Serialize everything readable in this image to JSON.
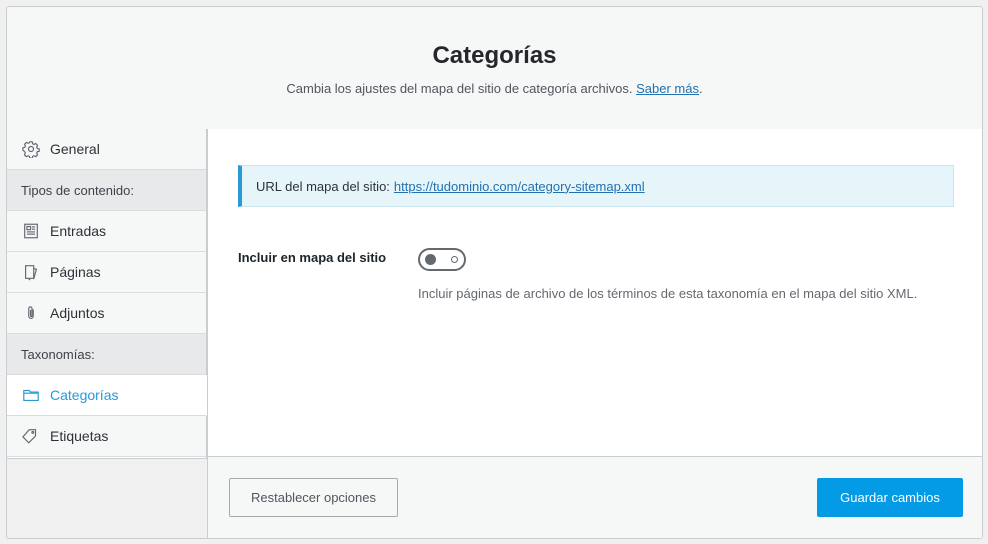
{
  "header": {
    "title": "Categorías",
    "description": "Cambia los ajustes del mapa del sitio de categoría archivos.",
    "learn_more": "Saber más",
    "trailing": "."
  },
  "sidebar": {
    "general": {
      "label": "General",
      "icon": "gear-icon"
    },
    "content_types_heading": "Tipos de contenido:",
    "entradas": {
      "label": "Entradas",
      "icon": "document-icon"
    },
    "paginas": {
      "label": "Páginas",
      "icon": "page-icon"
    },
    "adjuntos": {
      "label": "Adjuntos",
      "icon": "paperclip-icon"
    },
    "taxonomies_heading": "Taxonomías:",
    "categorias": {
      "label": "Categorías",
      "icon": "folder-icon",
      "active": true
    },
    "etiquetas": {
      "label": "Etiquetas",
      "icon": "tag-icon"
    }
  },
  "main": {
    "sitemap_url_label": "URL del mapa del sitio:",
    "sitemap_url": "https://tudominio.com/category-sitemap.xml",
    "include_label": "Incluir en mapa del sitio",
    "include_enabled": false,
    "include_description": "Incluir páginas de archivo de los términos de esta taxonomía en el mapa del sitio XML."
  },
  "footer": {
    "reset_label": "Restablecer opciones",
    "save_label": "Guardar cambios"
  },
  "colors": {
    "accent": "#039be5",
    "active_nav": "#2a9ad6",
    "link": "#2271b1"
  }
}
